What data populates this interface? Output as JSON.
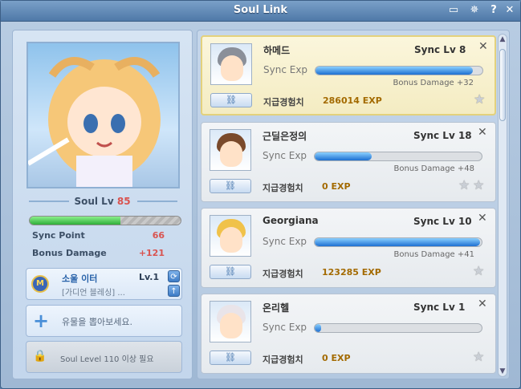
{
  "window": {
    "title": "Soul Link"
  },
  "titlebar_icons": [
    "chat-icon",
    "settings-wheel-icon",
    "help-icon",
    "close-icon"
  ],
  "left": {
    "soul_lv_label": "Soul Lv",
    "soul_lv_value": "85",
    "sync_progress": 0.6,
    "stats": [
      {
        "label": "Sync Point",
        "value": "66"
      },
      {
        "label": "Bonus Damage",
        "value": "+121"
      }
    ],
    "item": {
      "name": "소울 이터",
      "level": "Lv.1",
      "desc": "[가디언 블레싱] ..."
    },
    "add": {
      "text": "유물을 뽑아보세요."
    },
    "lock": {
      "text": "Soul Level 110 이상 필요"
    }
  },
  "list": {
    "sync_exp_label": "Sync Exp",
    "exp_label": "지급경험치",
    "cards": [
      {
        "name": "하메드",
        "level": "Sync Lv 8",
        "progress": 0.94,
        "bonus": "Bonus Damage +32",
        "exp": "286014 EXP",
        "stars": 1,
        "selected": true
      },
      {
        "name": "근딜은정의",
        "level": "Sync Lv 18",
        "progress": 0.34,
        "bonus": "Bonus Damage +48",
        "exp": "0 EXP",
        "stars": 2,
        "selected": false
      },
      {
        "name": "Georgiana",
        "level": "Sync Lv 10",
        "progress": 0.99,
        "bonus": "Bonus Damage +41",
        "exp": "123285 EXP",
        "stars": 1,
        "selected": false
      },
      {
        "name": "온리헬",
        "level": "Sync Lv 1",
        "progress": 0.04,
        "bonus": "",
        "exp": "0 EXP",
        "stars": 1,
        "selected": false
      }
    ]
  }
}
